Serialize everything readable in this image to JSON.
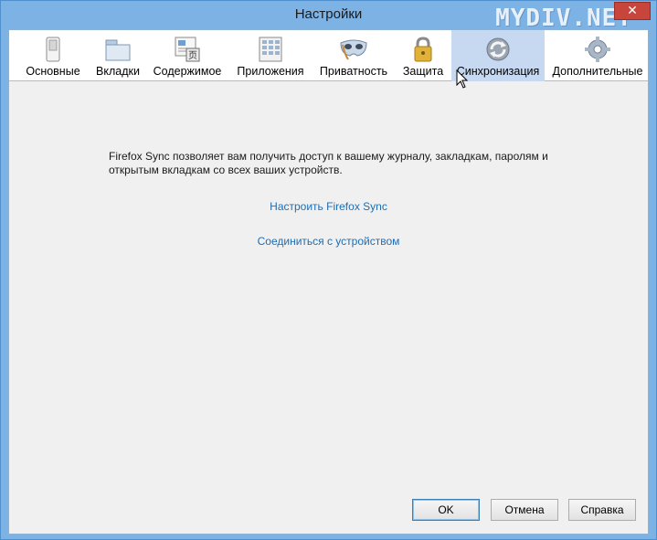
{
  "window": {
    "title": "Настройки",
    "watermark": "MYDIV.NET",
    "close_glyph": "✕"
  },
  "tabs": [
    {
      "label": "Основные",
      "icon": "switch-icon",
      "selected": false
    },
    {
      "label": "Вкладки",
      "icon": "tabs-folder-icon",
      "selected": false
    },
    {
      "label": "Содержимое",
      "icon": "content-page-icon",
      "selected": false
    },
    {
      "label": "Приложения",
      "icon": "applications-grid-icon",
      "selected": false
    },
    {
      "label": "Приватность",
      "icon": "mask-icon",
      "selected": false
    },
    {
      "label": "Защита",
      "icon": "padlock-icon",
      "selected": false
    },
    {
      "label": "Синхронизация",
      "icon": "sync-arrows-icon",
      "selected": true
    },
    {
      "label": "Дополнительные",
      "icon": "gear-icon",
      "selected": false
    }
  ],
  "sync": {
    "description_line1": "Firefox Sync позволяет вам получить доступ к вашему журналу, закладкам, паролям и",
    "description_line2": "открытым вкладкам со всех ваших устройств.",
    "setup_link": "Настроить Firefox Sync",
    "pair_link": "Соединиться с устройством"
  },
  "buttons": {
    "ok": "OK",
    "cancel": "Отмена",
    "help": "Справка"
  },
  "colors": {
    "selected_tab": "#c6d9f0",
    "link": "#1e6db3",
    "window_frame": "#7db2e4"
  }
}
